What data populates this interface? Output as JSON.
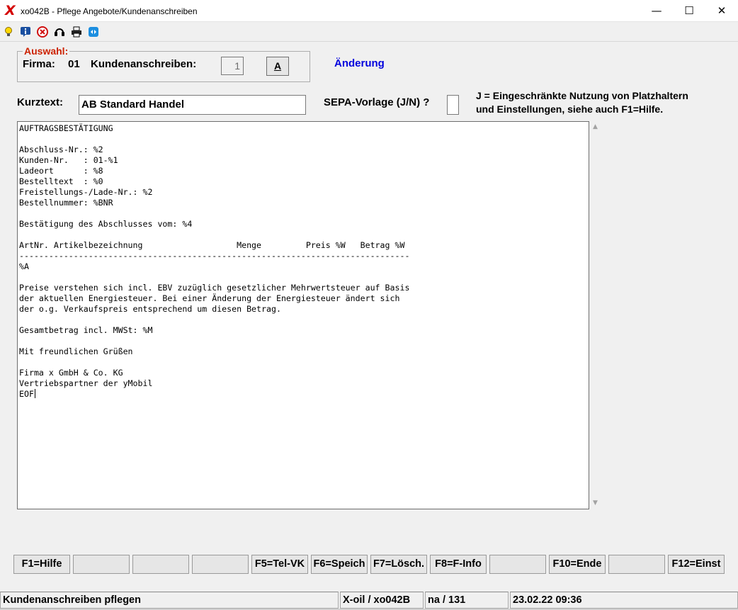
{
  "window": {
    "app_icon": "X",
    "title": "xo042B - Pflege Angebote/Kundenanschreiben",
    "minimize": "—",
    "maximize": "☐",
    "close": "✕"
  },
  "toolbar": {
    "icons": [
      "lightbulb-icon",
      "info-icon",
      "cancel-icon",
      "headset-icon",
      "printer-icon",
      "remote-icon"
    ]
  },
  "auswahl": {
    "legend": "Auswahl:",
    "firma_label": "Firma:",
    "firma_value": "01",
    "kundenanschreiben_label": "Kundenanschreiben:",
    "kundenanschreiben_value": "1",
    "button_label": "A"
  },
  "mode_label": "Änderung",
  "kurztext": {
    "label": "Kurztext:",
    "value": "AB Standard Handel"
  },
  "sepa": {
    "label": "SEPA-Vorlage (J/N) ?",
    "value": ""
  },
  "note": {
    "line1": "J = Eingeschränkte Nutzung von Platzhaltern",
    "line2": "und Einstellungen, siehe auch F1=Hilfe."
  },
  "editor": {
    "content": "AUFTRAGSBESTÄTIGUNG\n\nAbschluss-Nr.: %2\nKunden-Nr.   : 01-%1\nLadeort      : %8\nBestelltext  : %0\nFreistellungs-/Lade-Nr.: %2\nBestellnummer: %BNR\n\nBestätigung des Abschlusses vom: %4\n\nArtNr. Artikelbezeichnung                   Menge         Preis %W   Betrag %W\n-------------------------------------------------------------------------------\n%A\n\nPreise verstehen sich incl. EBV zuzüglich gesetzlicher Mehrwertsteuer auf Basis\nder aktuellen Energiesteuer. Bei einer Änderung der Energiesteuer ändert sich\nder o.g. Verkaufspreis entsprechend um diesen Betrag.\n\nGesamtbetrag incl. MWSt: %M\n\nMit freundlichen Grüßen\n\nFirma x GmbH & Co. KG\nVertriebspartner der yMobil\nEOF"
  },
  "function_keys": [
    {
      "label": "F1=Hilfe"
    },
    {
      "label": ""
    },
    {
      "label": ""
    },
    {
      "label": ""
    },
    {
      "label": "F5=Tel-VK"
    },
    {
      "label": "F6=Speich"
    },
    {
      "label": "F7=Lösch."
    },
    {
      "label": "F8=F-Info"
    },
    {
      "label": ""
    },
    {
      "label": "F10=Ende"
    },
    {
      "label": ""
    },
    {
      "label": "F12=Einst"
    }
  ],
  "statusbar": {
    "message": "Kundenanschreiben pflegen",
    "program": "X-oil / xo042B",
    "record": "na / 131",
    "datetime": "23.02.22 09:36"
  },
  "colors": {
    "legend": "#cc2200",
    "mode": "#0000dd",
    "app_icon": "#d40000"
  }
}
